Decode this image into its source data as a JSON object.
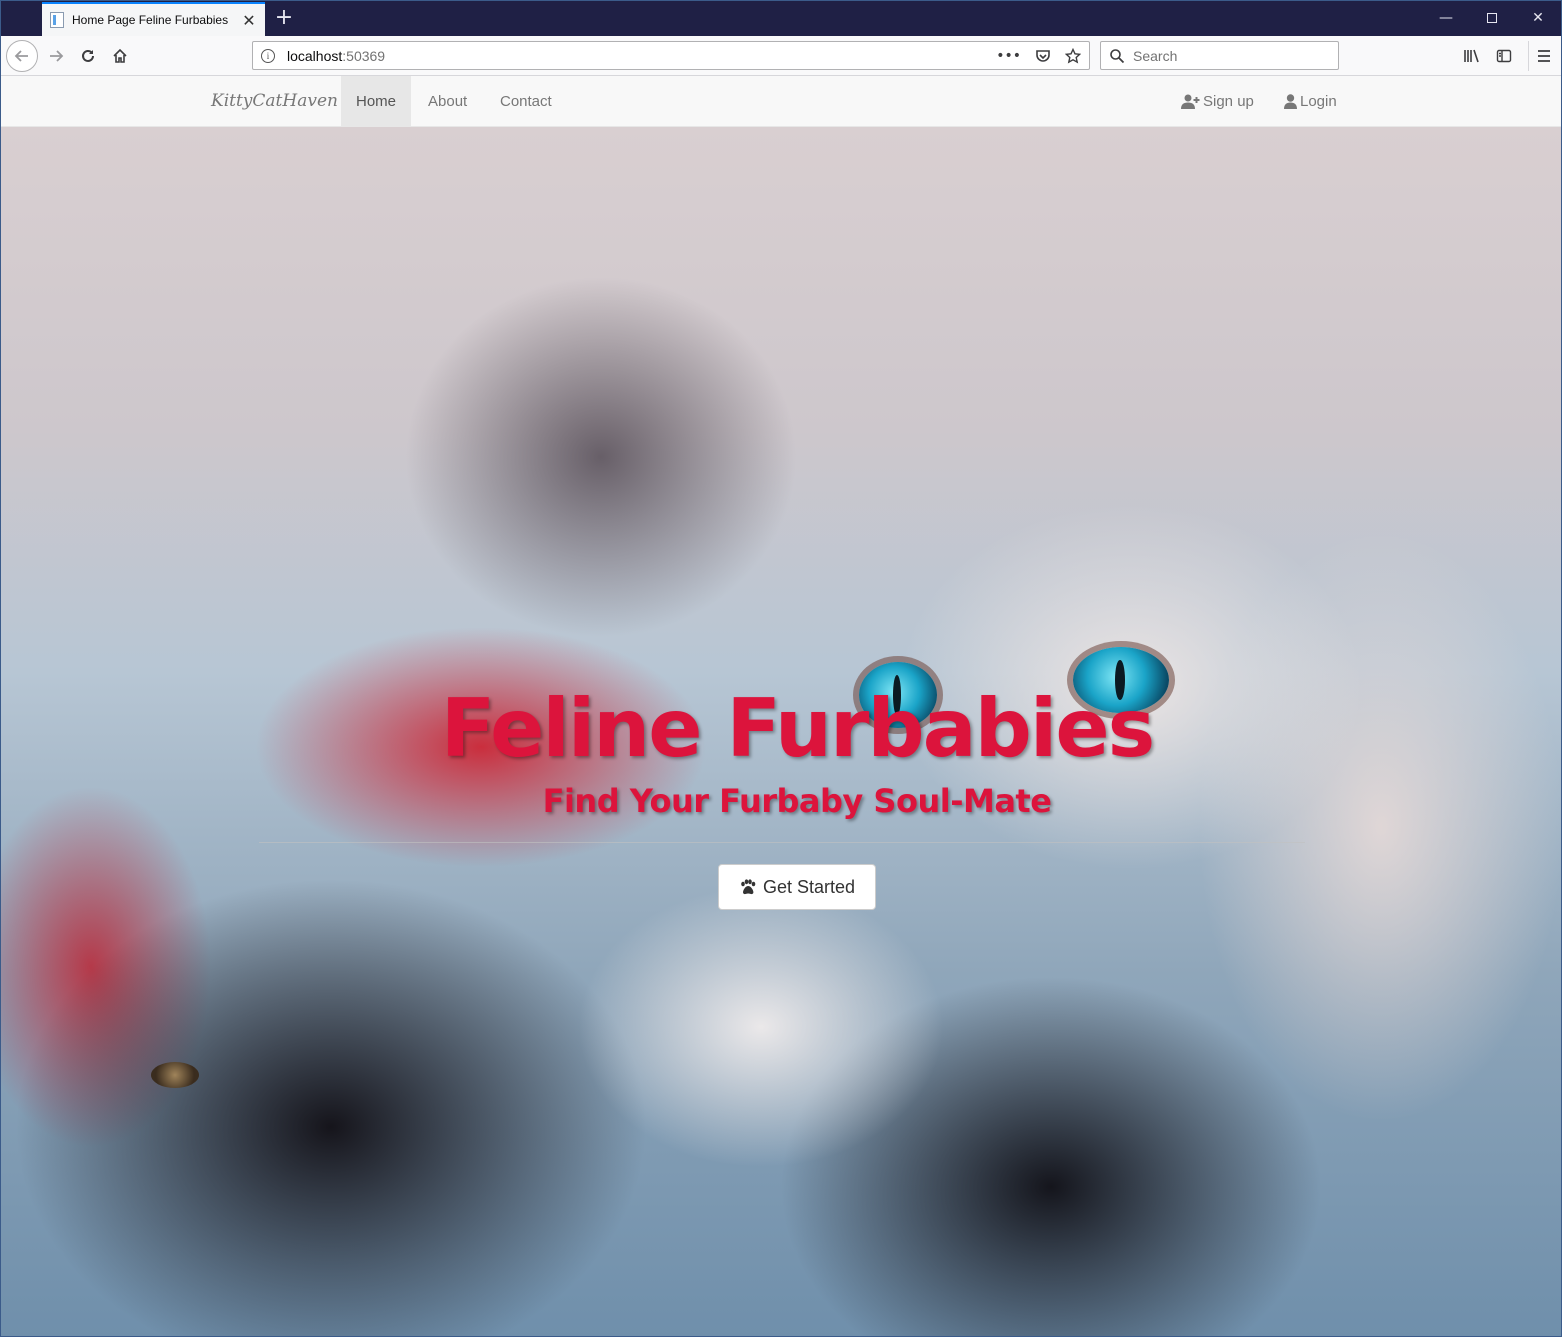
{
  "browser": {
    "tab_title": "Home Page Feline Furbabies",
    "new_tab": "+",
    "url_host": "localhost",
    "url_port": ":50369",
    "search_placeholder": "Search"
  },
  "site": {
    "brand": "KittyCatHaven",
    "nav": {
      "home": "Home",
      "about": "About",
      "contact": "Contact",
      "signup": "Sign up",
      "login": "Login"
    }
  },
  "hero": {
    "title": "Feline Furbabies",
    "subtitle": "Find Your Furbaby Soul-Mate",
    "cta_label": "Get Started"
  },
  "colors": {
    "accent": "#dc143c",
    "titlebar": "#1f2045",
    "tab_highlight": "#0a84ff"
  },
  "icons": {
    "tab": "page-icon",
    "back": "arrow-left-icon",
    "forward": "arrow-right-icon",
    "reload": "reload-icon",
    "home": "home-icon",
    "info": "info-icon",
    "more": "ellipsis-icon",
    "pocket": "pocket-icon",
    "bookmark": "star-icon",
    "search": "search-icon",
    "library": "library-icon",
    "sidebar": "sidebar-icon",
    "menu": "hamburger-icon",
    "signup": "user-plus-icon",
    "login": "user-icon",
    "cta": "paw-icon"
  }
}
